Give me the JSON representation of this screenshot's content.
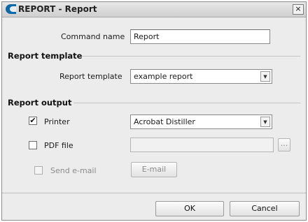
{
  "window": {
    "title": "REPORT - Report",
    "close_glyph": "×",
    "icon": "app-logo-icon"
  },
  "command_name": {
    "label": "Command name",
    "value": "Report"
  },
  "report_template": {
    "section_title": "Report template",
    "label": "Report template",
    "selected": "example report",
    "arrow": "▼"
  },
  "report_output": {
    "section_title": "Report output",
    "printer": {
      "label": "Printer",
      "checked": true,
      "check_glyph": "✔",
      "selected": "Acrobat Distiller",
      "arrow": "▼"
    },
    "pdf": {
      "label": "PDF file",
      "checked": false,
      "value": "",
      "browse_label": "..."
    },
    "email": {
      "label": "Send e-mail",
      "checked": false,
      "enabled": false,
      "button_label": "E-mail"
    }
  },
  "footer": {
    "ok_label": "OK",
    "cancel_label": "Cancel"
  }
}
